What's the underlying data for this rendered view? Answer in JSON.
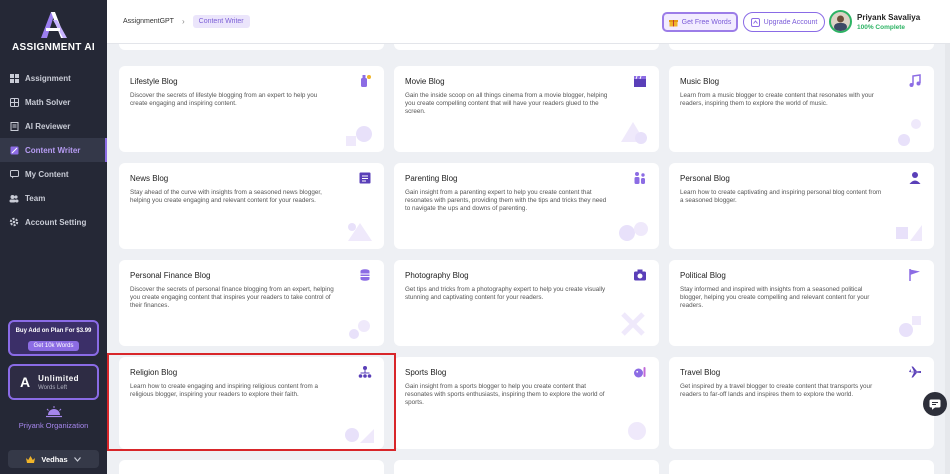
{
  "app": {
    "name": "ASSIGNMENT AI"
  },
  "sidebar": {
    "items": [
      {
        "label": "Assignment",
        "icon": "grid-icon",
        "active": false
      },
      {
        "label": "Math Solver",
        "icon": "calculator-icon",
        "active": false
      },
      {
        "label": "AI Reviewer",
        "icon": "document-icon",
        "active": false
      },
      {
        "label": "Content Writer",
        "icon": "pen-icon",
        "active": true
      },
      {
        "label": "My Content",
        "icon": "chat-icon",
        "active": false
      },
      {
        "label": "Team",
        "icon": "team-icon",
        "active": false
      },
      {
        "label": "Account Setting",
        "icon": "gear-icon",
        "active": false
      }
    ],
    "promo": {
      "title": "Buy Add on Plan For $3.99",
      "button": "Get 10k Words"
    },
    "plan": {
      "title": "Unlimited",
      "subtitle": "Words Left"
    },
    "org": {
      "name": "Priyank Organization"
    },
    "workspace": {
      "name": "Vedhas"
    }
  },
  "header": {
    "breadcrumb_root": "AssignmentGPT",
    "breadcrumb_current": "Content Writer",
    "free_words_label": "Get Free Words",
    "upgrade_label": "Upgrade Account",
    "user_name": "Priyank Savaliya",
    "user_progress": "100% Complete"
  },
  "cards": [
    {
      "title": "Lifestyle Blog",
      "desc": "Discover the secrets of lifestyle blogging from an expert to help you create engaging and inspiring content.",
      "icon": "bottle-icon"
    },
    {
      "title": "Movie Blog",
      "desc": "Gain the inside scoop on all things cinema from a movie blogger, helping you create compelling content that will have your readers glued to the screen.",
      "icon": "clapperboard-icon"
    },
    {
      "title": "Music Blog",
      "desc": "Learn from a music blogger to create content that resonates with your readers, inspiring them to explore the world of music.",
      "icon": "music-note-icon"
    },
    {
      "title": "News Blog",
      "desc": "Stay ahead of the curve with insights from a seasoned news blogger, helping you create engaging and relevant content for your readers.",
      "icon": "newspaper-icon"
    },
    {
      "title": "Parenting Blog",
      "desc": "Gain insight from a parenting expert to help you create content that resonates with parents, providing them with the tips and tricks they need to navigate the ups and downs of parenting.",
      "icon": "family-icon"
    },
    {
      "title": "Personal Blog",
      "desc": "Learn how to create captivating and inspiring personal blog content from a seasoned blogger.",
      "icon": "person-icon"
    },
    {
      "title": "Personal Finance Blog",
      "desc": "Discover the secrets of personal finance blogging from an expert, helping you create engaging content that inspires your readers to take control of their finances.",
      "icon": "coins-icon"
    },
    {
      "title": "Photography Blog",
      "desc": "Get tips and tricks from a photography expert to help you create visually stunning and captivating content for your readers.",
      "icon": "camera-icon"
    },
    {
      "title": "Political Blog",
      "desc": "Stay informed and inspired with insights from a seasoned political blogger, helping you create compelling and relevant content for your readers.",
      "icon": "flag-icon"
    },
    {
      "title": "Religion Blog",
      "desc": "Learn how to create engaging and inspiring religious content from a religious blogger, inspiring your readers to explore their faith.",
      "icon": "hierarchy-icon"
    },
    {
      "title": "Sports Blog",
      "desc": "Gain insight from a sports blogger to help you create content that resonates with sports enthusiasts, inspiring them to explore the world of sports.",
      "icon": "sports-ball-icon"
    },
    {
      "title": "Travel Blog",
      "desc": "Get inspired by a travel blogger to create content that transports your readers to far-off lands and inspires them to explore the world.",
      "icon": "airplane-icon"
    }
  ],
  "colors": {
    "accent": "#8c6ce4",
    "sidebar_bg": "#252836",
    "highlight": "#d8262a",
    "success": "#2db364"
  }
}
